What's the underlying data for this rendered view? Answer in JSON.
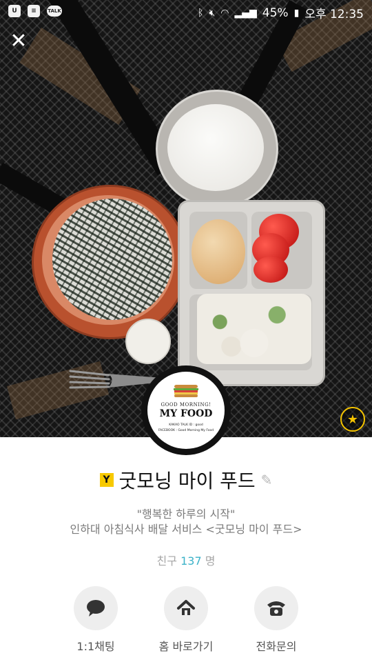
{
  "status_bar": {
    "left_icons": [
      "u-plus-icon",
      "message-icon",
      "talk-icon"
    ],
    "talk_label": "TALK",
    "battery": "45%",
    "time": "오후 12:35"
  },
  "cover": {
    "close_icon": "close-icon",
    "logo": {
      "tagline": "GOOD MORNING!",
      "brand": "MY FOOD",
      "line1": "KAKAO TALK ID   : good",
      "line2": "FACEBOOK  : Good Morning My Food"
    },
    "favorite_icon": "star-icon"
  },
  "profile": {
    "badge": "Y",
    "name": "굿모닝 마이 푸드",
    "status_message": "\"행복한 하루의 시작\"",
    "description": "인하대 아침식사 배달 서비스 <굿모닝 마이 푸드>",
    "friends_prefix": "친구",
    "friends_count": "137",
    "friends_suffix": "명"
  },
  "actions": [
    {
      "label": "1:1채팅",
      "icon": "chat-bubble-icon"
    },
    {
      "label": "홈 바로가기",
      "icon": "home-icon"
    },
    {
      "label": "전화문의",
      "icon": "phone-icon"
    }
  ],
  "colors": {
    "badge": "#f7c900",
    "friends_count": "#3bb2c8",
    "favorite": "#f5c400"
  }
}
